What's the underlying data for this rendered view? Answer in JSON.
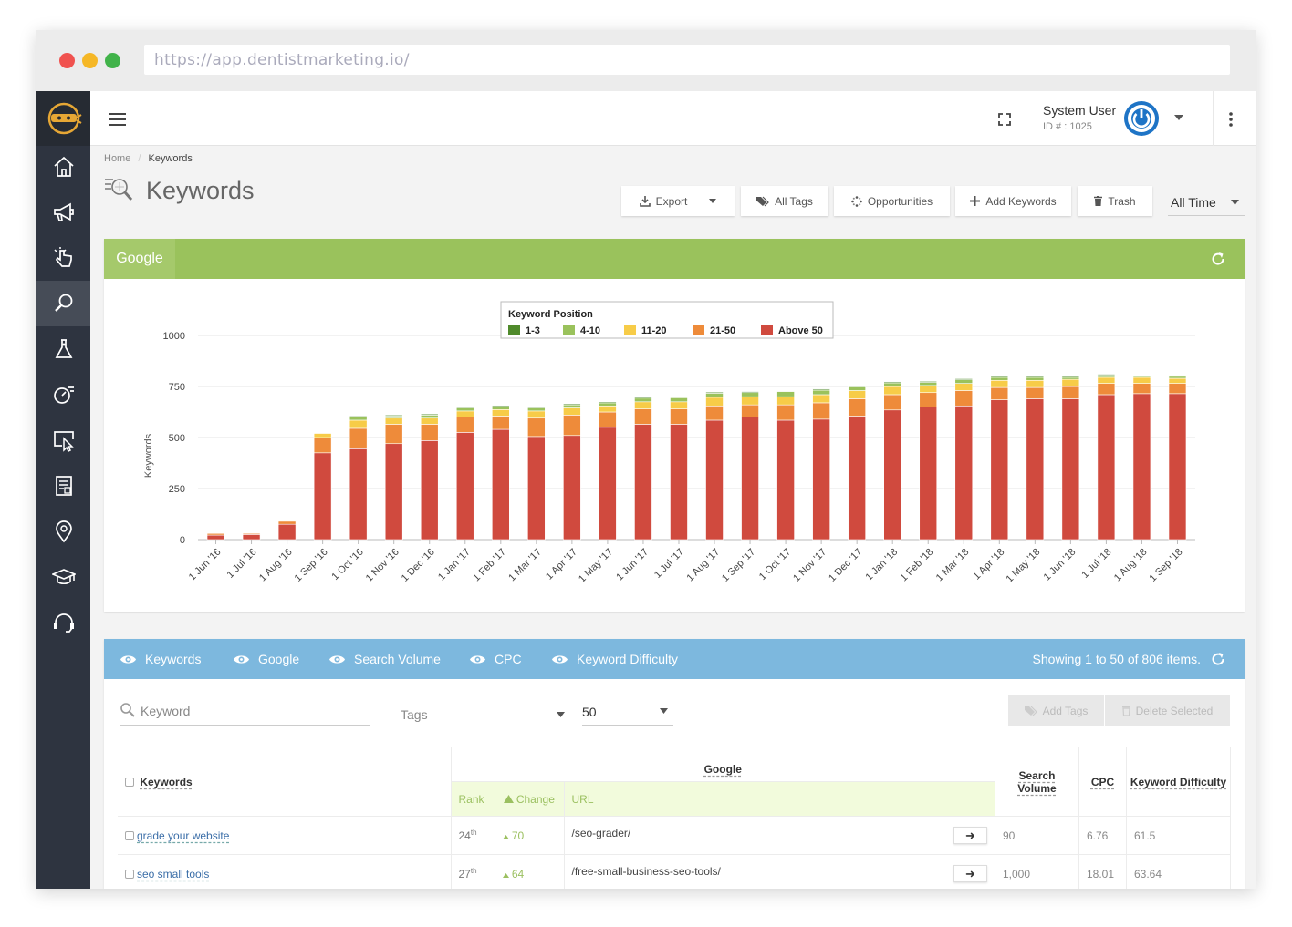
{
  "browser": {
    "url": "https://app.dentistmarketing.io/"
  },
  "header": {
    "user_name": "System User",
    "user_id": "ID # : 1025"
  },
  "breadcrumb": {
    "home": "Home",
    "separator": "/",
    "current": "Keywords"
  },
  "page_title": "Keywords",
  "toolbar": {
    "export": "Export",
    "all_tags": "All Tags",
    "opportunities": "Opportunities",
    "add_keywords": "Add Keywords",
    "trash": "Trash",
    "range": "All Time"
  },
  "google_panel": {
    "tab": "Google"
  },
  "chart_data": {
    "type": "bar",
    "stacked": true,
    "legend_title": "Keyword Position",
    "legend_position": "top-center",
    "ylabel": "Keywords",
    "ylim": [
      0,
      1000
    ],
    "yticks": [
      0,
      250,
      500,
      750,
      1000
    ],
    "grid": true,
    "categories": [
      "1 Jun '16",
      "1 Jul '16",
      "1 Aug '16",
      "1 Sep '16",
      "1 Oct '16",
      "1 Nov '16",
      "1 Dec '16",
      "1 Jan '17",
      "1 Feb '17",
      "1 Mar '17",
      "1 Apr '17",
      "1 May '17",
      "1 Jun '17",
      "1 Jul '17",
      "1 Aug '17",
      "1 Sep '17",
      "1 Oct '17",
      "1 Nov '17",
      "1 Dec '17",
      "1 Jan '18",
      "1 Feb '18",
      "1 Mar '18",
      "1 Apr '18",
      "1 May '18",
      "1 Jun '18",
      "1 Jul '18",
      "1 Aug '18",
      "1 Sep '18"
    ],
    "series": [
      {
        "name": "Above 50",
        "color": "#d04a3e",
        "values": [
          22,
          25,
          75,
          425,
          445,
          470,
          485,
          525,
          540,
          505,
          510,
          550,
          565,
          565,
          585,
          600,
          585,
          590,
          605,
          635,
          650,
          655,
          685,
          690,
          690,
          710,
          715,
          715
        ]
      },
      {
        "name": "21-50",
        "color": "#ee8b3a",
        "values": [
          8,
          5,
          15,
          75,
          100,
          95,
          80,
          75,
          65,
          90,
          100,
          75,
          75,
          75,
          70,
          60,
          75,
          80,
          85,
          75,
          70,
          75,
          60,
          55,
          60,
          55,
          50,
          50
        ]
      },
      {
        "name": "11-20",
        "color": "#f7cc48",
        "values": [
          0,
          0,
          3,
          20,
          40,
          30,
          30,
          30,
          32,
          35,
          35,
          30,
          35,
          35,
          42,
          40,
          40,
          40,
          40,
          40,
          35,
          35,
          35,
          35,
          35,
          30,
          30,
          25
        ]
      },
      {
        "name": "4-10",
        "color": "#9ac25c",
        "values": [
          0,
          0,
          2,
          0,
          15,
          10,
          15,
          15,
          15,
          15,
          15,
          15,
          18,
          20,
          20,
          20,
          25,
          22,
          18,
          18,
          15,
          18,
          15,
          15,
          10,
          10,
          5,
          10
        ]
      },
      {
        "name": "1-3",
        "color": "#4f8a2b",
        "values": [
          0,
          0,
          0,
          0,
          5,
          5,
          5,
          5,
          5,
          5,
          5,
          5,
          5,
          5,
          5,
          5,
          0,
          5,
          5,
          5,
          5,
          5,
          5,
          5,
          5,
          5,
          0,
          5
        ]
      }
    ]
  },
  "bottom_panel": {
    "tabs": [
      "Keywords",
      "Google",
      "Search Volume",
      "CPC",
      "Keyword Difficulty"
    ],
    "status": "Showing 1 to 50 of 806 items."
  },
  "filters": {
    "keyword_placeholder": "Keyword",
    "tags_placeholder": "Tags",
    "page_size": "50",
    "add_tags": "Add Tags",
    "delete_selected": "Delete Selected"
  },
  "table": {
    "col_keywords": "Keywords",
    "col_google": "Google",
    "col_rank": "Rank",
    "col_change": "Change",
    "col_url": "URL",
    "col_search_volume": "Search Volume",
    "col_cpc": "CPC",
    "col_difficulty": "Keyword Difficulty",
    "rows": [
      {
        "keyword": "grade your website",
        "rank": "24",
        "rank_suffix": "th",
        "change": "70",
        "url": "/seo-grader/",
        "volume": "90",
        "cpc": "6.76",
        "difficulty": "61.5"
      },
      {
        "keyword": "seo small tools",
        "rank": "27",
        "rank_suffix": "th",
        "change": "64",
        "url": "/free-small-business-seo-tools/",
        "volume": "1,000",
        "cpc": "18.01",
        "difficulty": "63.64"
      }
    ]
  }
}
